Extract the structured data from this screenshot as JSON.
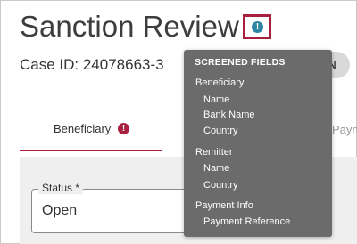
{
  "header": {
    "title": "Sanction Review",
    "case_id": "Case ID: 24078663-3",
    "pill_text": "N",
    "info_icon_glyph": "!"
  },
  "tabs": {
    "active_label": "Beneficiary",
    "active_badge": "!",
    "next_label_partial": "Payn"
  },
  "form": {
    "status_label": "Status *",
    "status_value": "Open"
  },
  "tooltip": {
    "header": "SCREENED FIELDS",
    "groups": [
      {
        "title": "Beneficiary",
        "items": [
          "Name",
          "Bank Name",
          "Country"
        ]
      },
      {
        "title": "Remitter",
        "items": [
          "Name",
          "Country"
        ]
      },
      {
        "title": "Payment Info",
        "items": [
          "Payment Reference"
        ]
      }
    ]
  },
  "colors": {
    "accent": "#a8203e",
    "info": "#2d86a5",
    "tooltip_bg": "#6b6b6b"
  }
}
